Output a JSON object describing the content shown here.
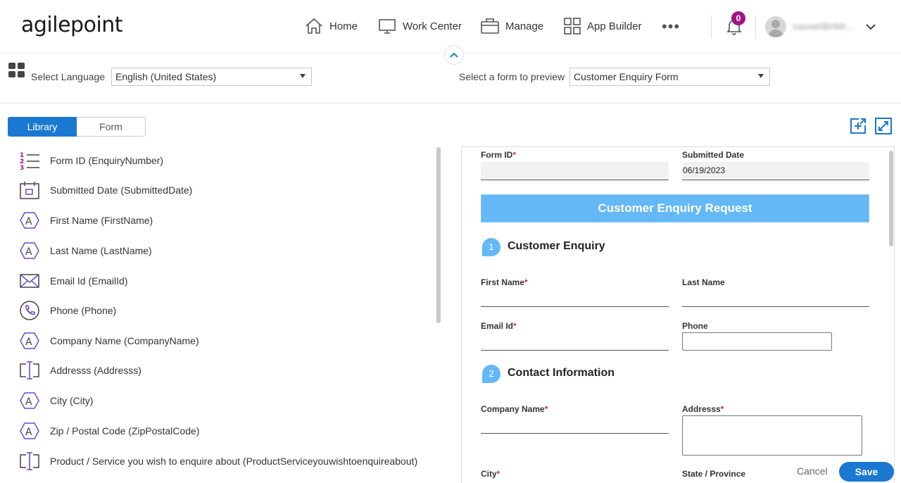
{
  "app": {
    "logo_text": "agilepoint",
    "nav": [
      {
        "label": "Home",
        "icon": "home-icon"
      },
      {
        "label": "Work Center",
        "icon": "monitor-icon"
      },
      {
        "label": "Manage",
        "icon": "briefcase-icon"
      },
      {
        "label": "App Builder",
        "icon": "app-grid-icon"
      }
    ],
    "more_label": "•••",
    "notifications_count": "0",
    "username": "nasnet\\BHMI...",
    "accent_color": "#1b78d0",
    "badge_color": "#a0157e"
  },
  "toolbar": {
    "select_language_label": "Select Language",
    "language_value": "English (United States)",
    "select_form_label": "Select a form to preview",
    "form_value": "Customer Enquiry Form"
  },
  "tabs": {
    "library": "Library",
    "form": "Form"
  },
  "library": [
    {
      "label": "Form ID (EnquiryNumber)",
      "icon": "numbered-list-icon"
    },
    {
      "label": "Submitted Date (SubmittedDate)",
      "icon": "calendar-icon"
    },
    {
      "label": "First Name (FirstName)",
      "icon": "text-field-icon"
    },
    {
      "label": "Last Name (LastName)",
      "icon": "text-field-icon"
    },
    {
      "label": "Email Id (EmailId)",
      "icon": "email-icon"
    },
    {
      "label": "Phone (Phone)",
      "icon": "phone-icon"
    },
    {
      "label": "Company Name (CompanyName)",
      "icon": "text-field-icon"
    },
    {
      "label": "Addresss (Addresss)",
      "icon": "multiline-text-icon"
    },
    {
      "label": "City (City)",
      "icon": "text-field-icon"
    },
    {
      "label": "Zip / Postal Code (ZipPostalCode)",
      "icon": "text-field-icon"
    },
    {
      "label": "Product / Service you wish to enquire about (ProductServiceyouwishtoenquireabout)",
      "icon": "multiline-text-icon"
    }
  ],
  "preview": {
    "form_id_label": "Form ID",
    "form_id_value": "",
    "submitted_date_label": "Submitted Date",
    "submitted_date_value": "06/19/2023",
    "banner_title": "Customer Enquiry Request",
    "section1_number": "1",
    "section1_title": "Customer Enquiry",
    "first_name_label": "First Name",
    "last_name_label": "Last Name",
    "email_label": "Email Id",
    "phone_label": "Phone",
    "section2_number": "2",
    "section2_title": "Contact Information",
    "company_label": "Company Name",
    "address_label": "Addresss",
    "city_label": "City",
    "state_label": "State / Province",
    "required_mark": "*"
  },
  "actions": {
    "cancel": "Cancel",
    "save": "Save"
  }
}
